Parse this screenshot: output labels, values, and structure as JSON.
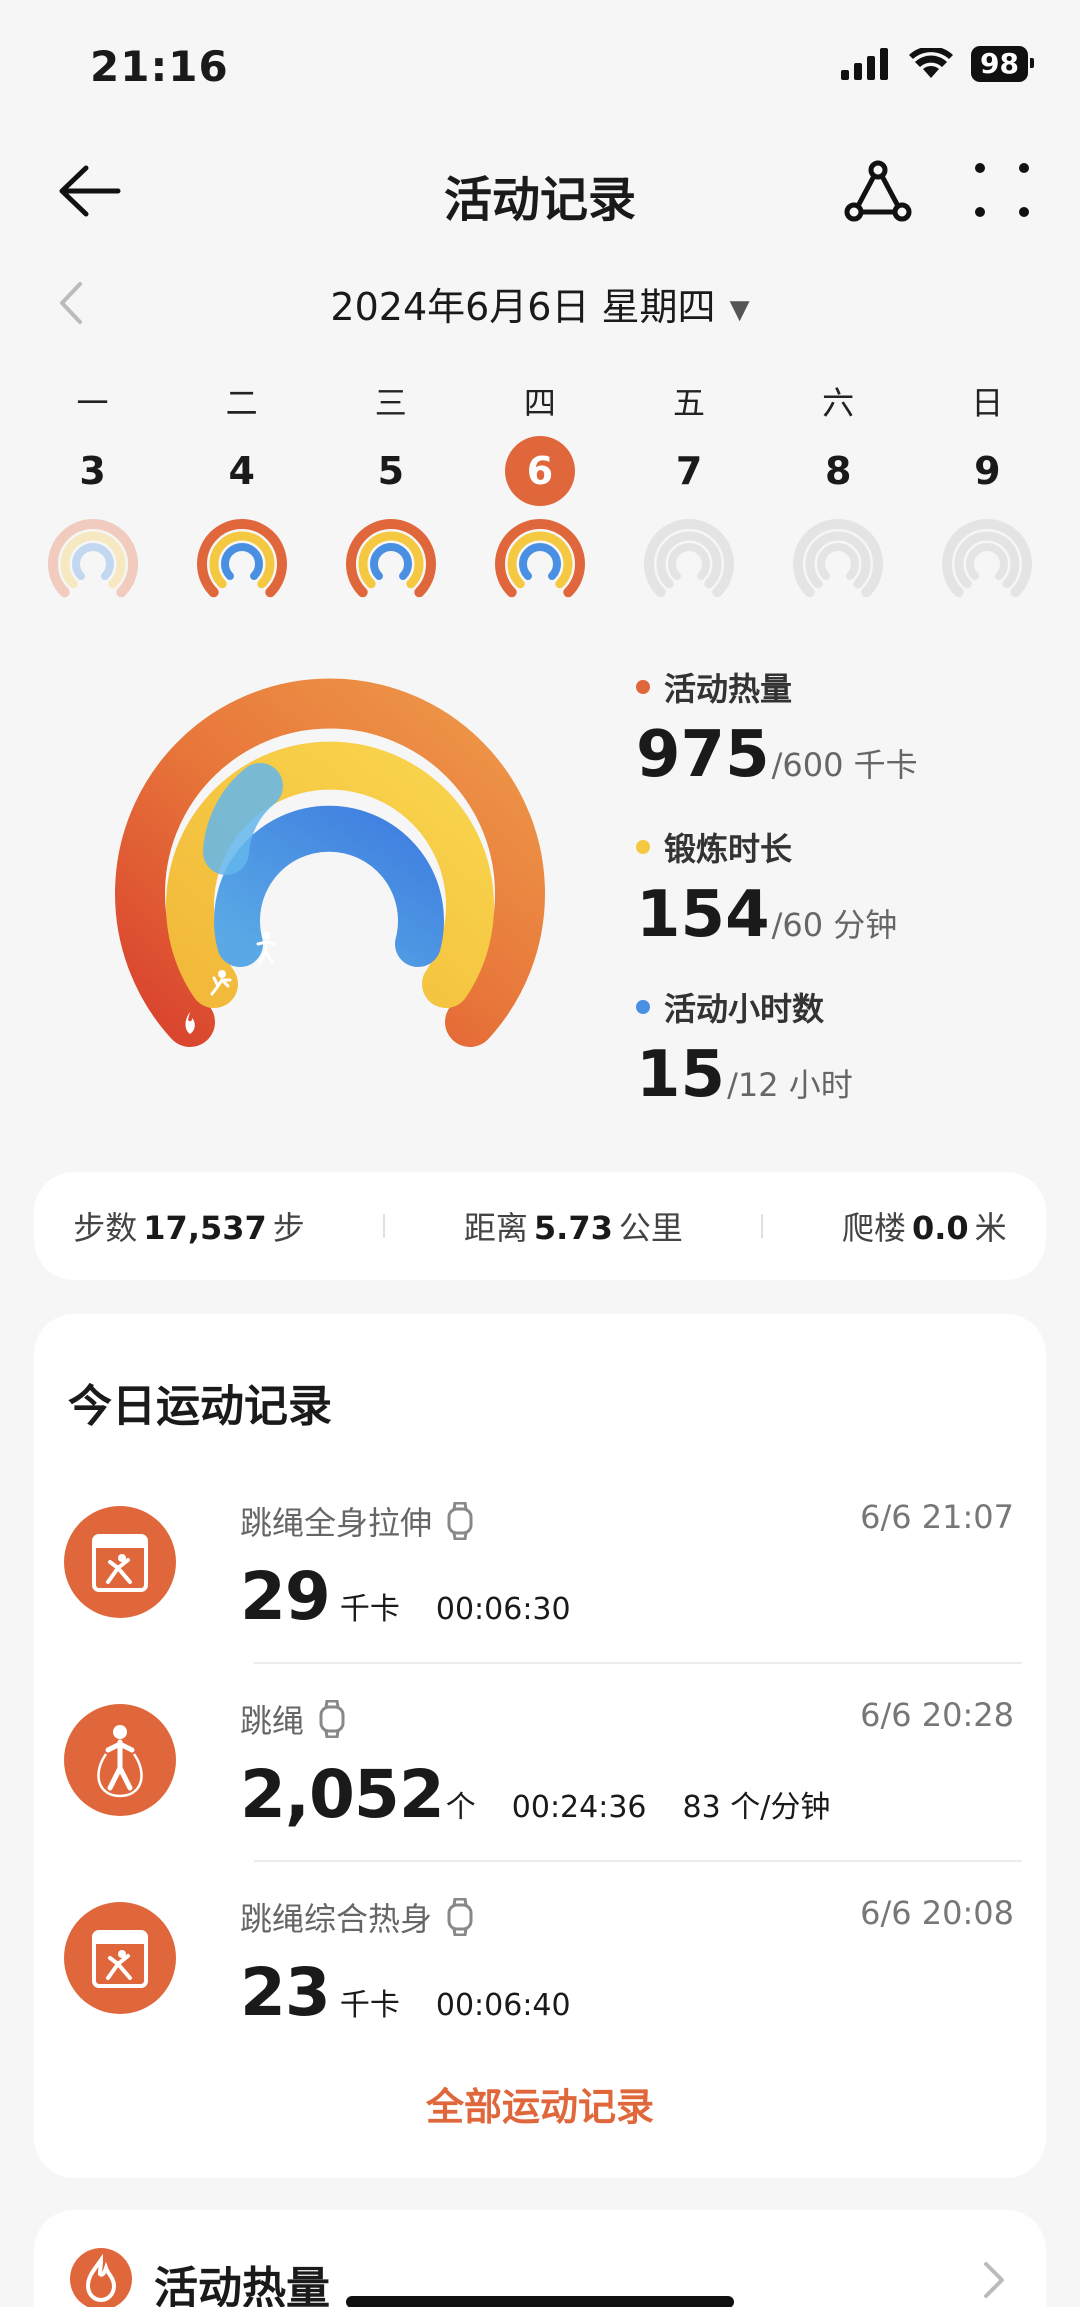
{
  "status_bar": {
    "time": "21:16",
    "battery": "98"
  },
  "header": {
    "title": "活动记录"
  },
  "date_selector": {
    "label": "2024年6月6日 星期四"
  },
  "week": [
    {
      "weekday": "一",
      "date": "3",
      "active": false,
      "has_data": true
    },
    {
      "weekday": "二",
      "date": "4",
      "active": false,
      "has_data": true
    },
    {
      "weekday": "三",
      "date": "5",
      "active": false,
      "has_data": true
    },
    {
      "weekday": "四",
      "date": "6",
      "active": true,
      "has_data": true
    },
    {
      "weekday": "五",
      "date": "7",
      "active": false,
      "has_data": false
    },
    {
      "weekday": "六",
      "date": "8",
      "active": false,
      "has_data": false
    },
    {
      "weekday": "日",
      "date": "9",
      "active": false,
      "has_data": false
    }
  ],
  "activity": {
    "calories": {
      "name": "活动热量",
      "value": "975",
      "goal": "/600 千卡",
      "color": "#e0673b"
    },
    "exercise": {
      "name": "锻炼时长",
      "value": "154",
      "goal": "/60 分钟",
      "color": "#f5c842"
    },
    "stand": {
      "name": "活动小时数",
      "value": "15",
      "goal": "/12 小时",
      "color": "#4a90e2"
    }
  },
  "summary": {
    "steps": {
      "label": "步数",
      "value": "17,537",
      "unit": "步"
    },
    "distance": {
      "label": "距离",
      "value": "5.73",
      "unit": "公里"
    },
    "floors": {
      "label": "爬楼",
      "value": "0.0",
      "unit": "米"
    }
  },
  "records": {
    "title": "今日运动记录",
    "items": [
      {
        "name": "跳绳全身拉伸",
        "time": "6/6 21:07",
        "value": "29",
        "unit": "千卡",
        "extra1": "00:06:30",
        "extra2": ""
      },
      {
        "name": "跳绳",
        "time": "6/6 20:28",
        "value": "2,052",
        "unit": "个",
        "extra1": "00:24:36",
        "extra2": "83 个/分钟"
      },
      {
        "name": "跳绳综合热身",
        "time": "6/6 20:08",
        "value": "23",
        "unit": "千卡",
        "extra1": "00:06:40",
        "extra2": ""
      }
    ],
    "all_link": "全部运动记录"
  },
  "bottom_card": {
    "title": "活动热量"
  },
  "colors": {
    "accent": "#e0673b",
    "yellow": "#f5c842",
    "blue": "#4a90e2",
    "inactive_ring": "#e4e4e4"
  }
}
